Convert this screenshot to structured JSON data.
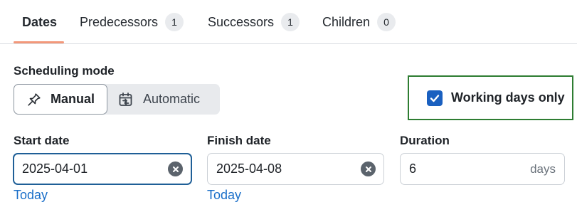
{
  "tabs": [
    {
      "label": "Dates",
      "count": null,
      "active": true
    },
    {
      "label": "Predecessors",
      "count": "1"
    },
    {
      "label": "Successors",
      "count": "1"
    },
    {
      "label": "Children",
      "count": "0"
    }
  ],
  "scheduling": {
    "label": "Scheduling mode",
    "manual_label": "Manual",
    "manual_icon": "pin-icon",
    "automatic_label": "Automatic",
    "automatic_icon": "calendar-icon",
    "selected": "Manual"
  },
  "working_days": {
    "label": "Working days only",
    "checked": true,
    "highlight_color": "#2e7d32"
  },
  "start_date": {
    "label": "Start date",
    "value": "2025-04-01",
    "today_link": "Today"
  },
  "finish_date": {
    "label": "Finish date",
    "value": "2025-04-08",
    "today_link": "Today"
  },
  "duration": {
    "label": "Duration",
    "value": "6",
    "unit": "days"
  },
  "colors": {
    "accent": "#f3987a",
    "link": "#1a6fc9",
    "checkbox": "#1a60c0",
    "focus": "#1f5f97"
  }
}
